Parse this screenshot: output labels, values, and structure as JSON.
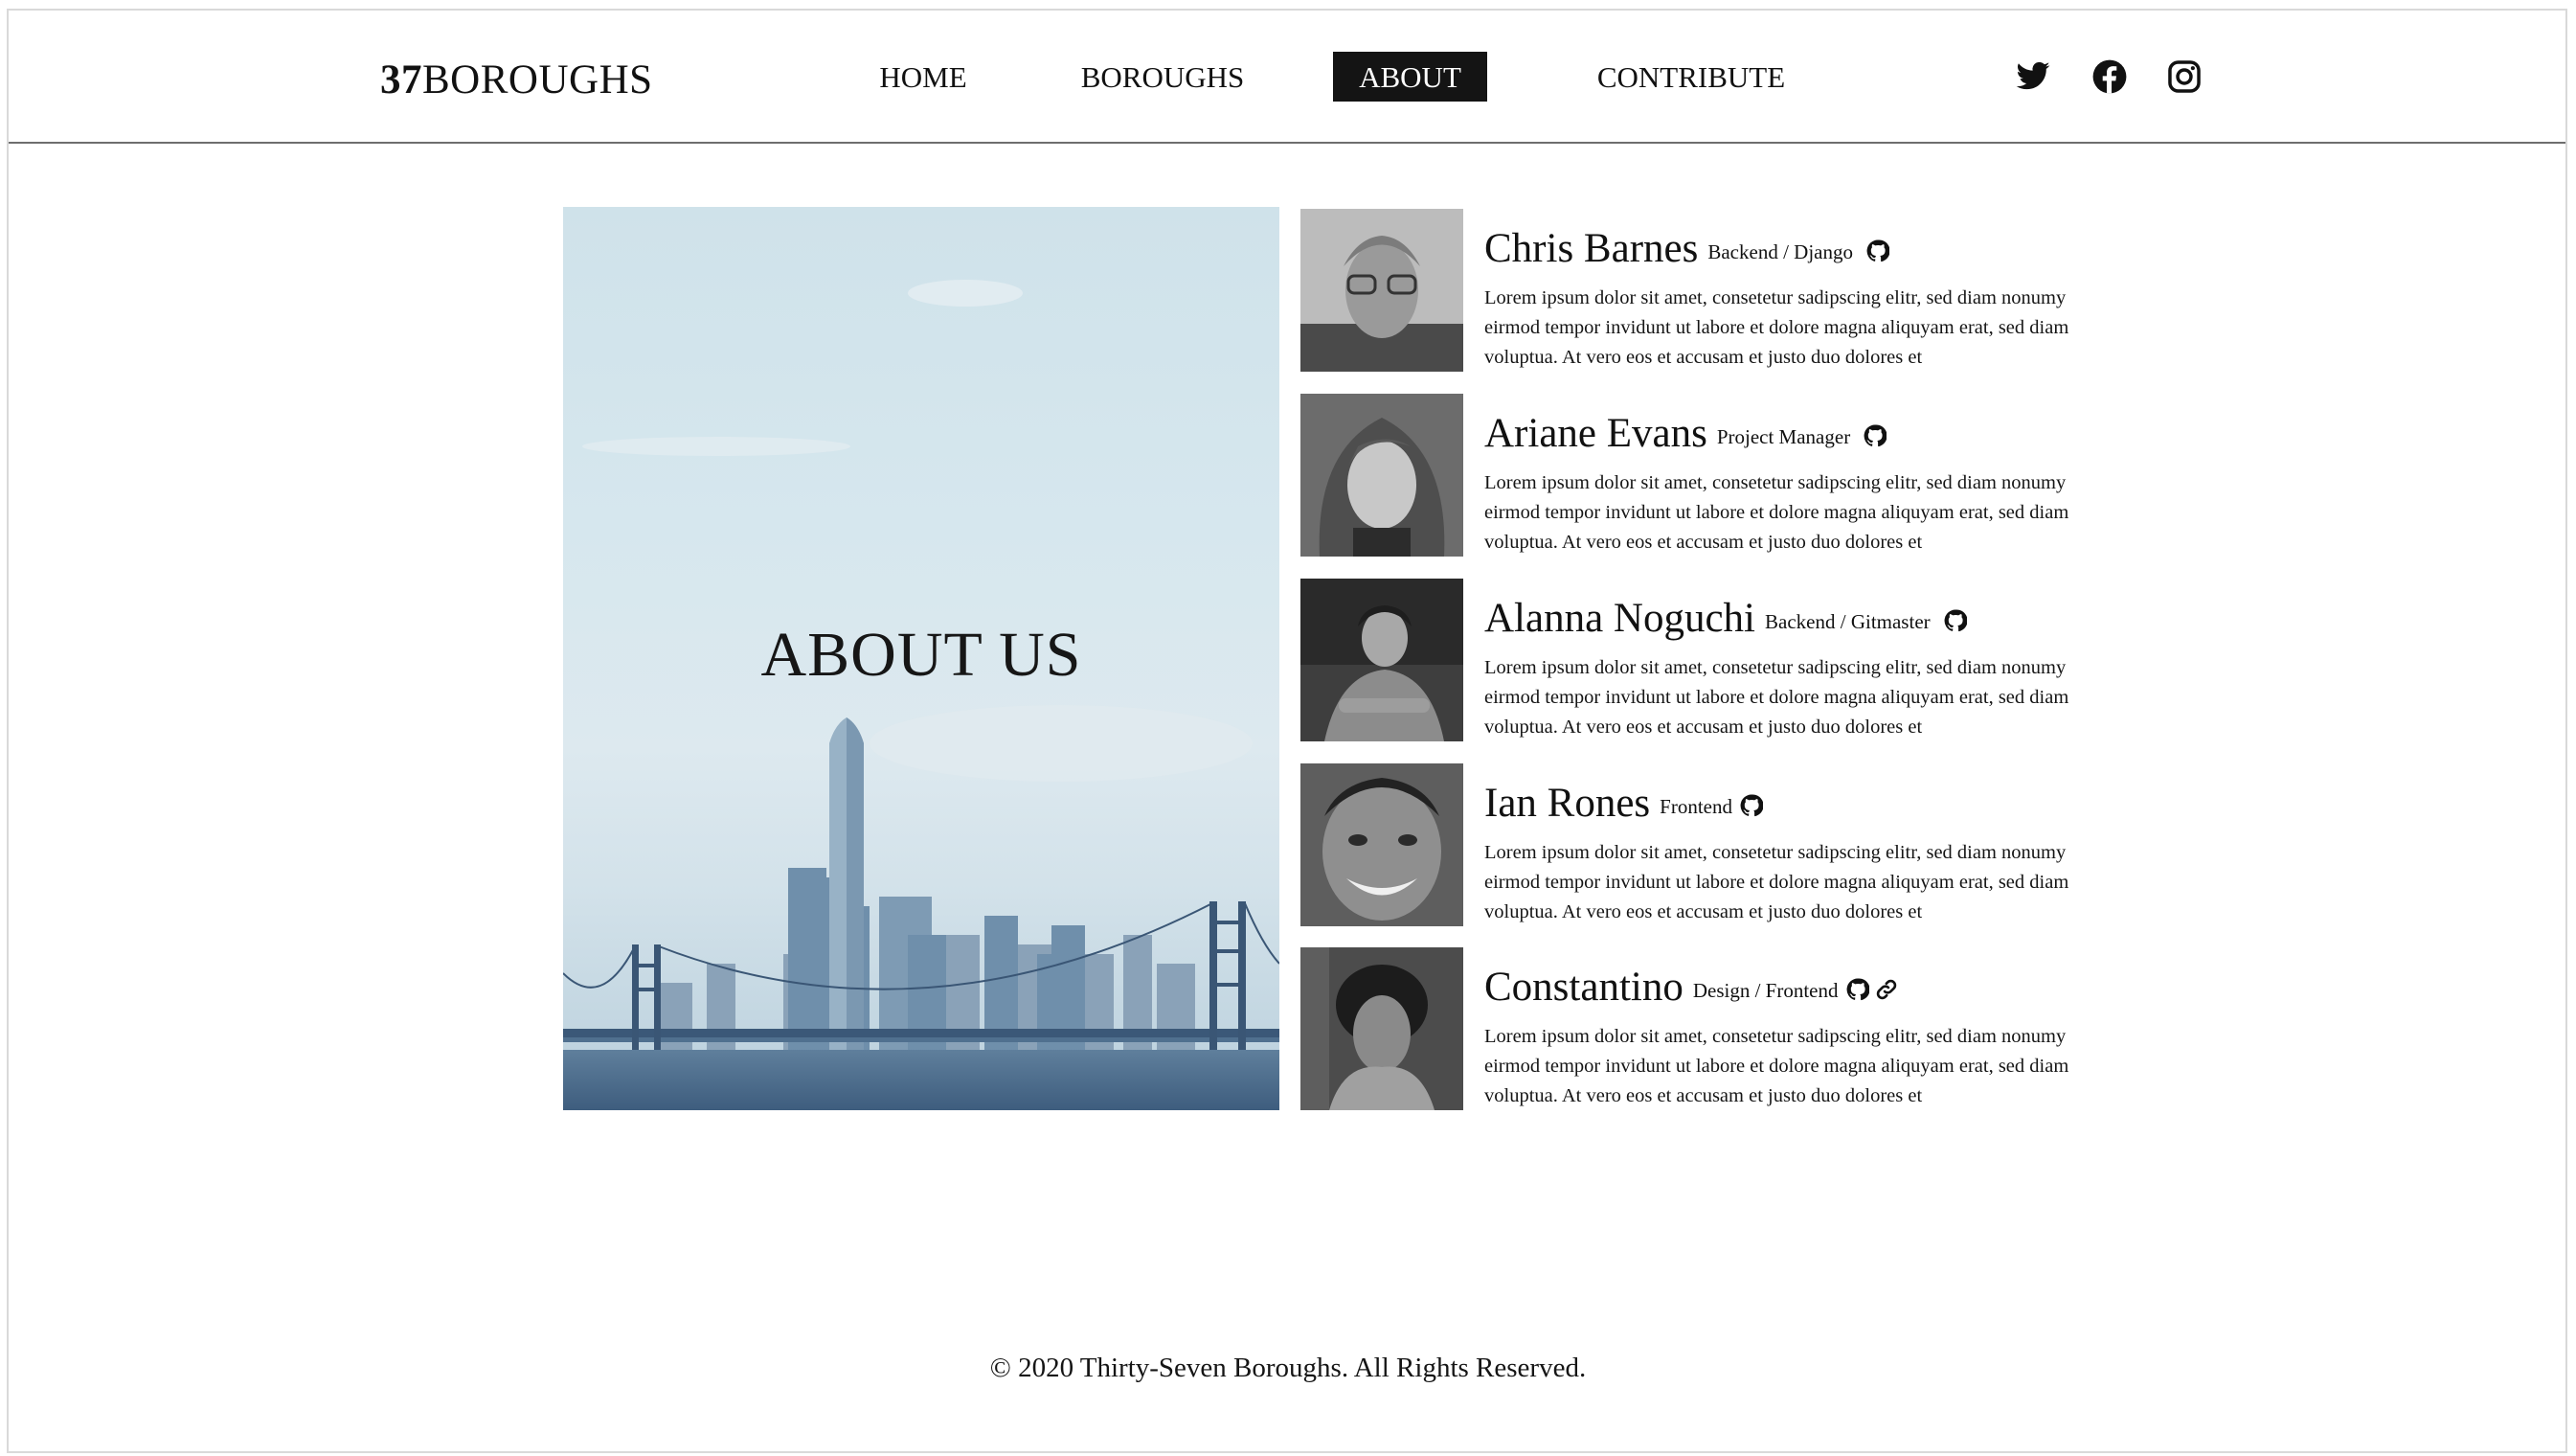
{
  "header": {
    "logo_number": "37",
    "logo_text": "BOROUGHS",
    "nav": [
      {
        "label": "HOME",
        "active": false
      },
      {
        "label": "BOROUGHS",
        "active": false
      },
      {
        "label": "ABOUT",
        "active": true
      },
      {
        "label": "CONTRIBUTE",
        "active": false
      }
    ],
    "social_icons": [
      "twitter-icon",
      "facebook-icon",
      "instagram-icon"
    ]
  },
  "hero": {
    "title": "ABOUT US"
  },
  "team": [
    {
      "name": "Chris Barnes",
      "role": "Backend / Django",
      "links": [
        "github-icon"
      ],
      "bio": "Lorem ipsum dolor sit amet, consetetur sadipscing elitr, sed diam nonumy eirmod tempor invidunt ut labore et dolore magna aliquyam erat, sed diam voluptua. At vero eos et accusam et justo duo dolores et"
    },
    {
      "name": "Ariane Evans",
      "role": "Project Manager",
      "links": [
        "github-icon"
      ],
      "bio": "Lorem ipsum dolor sit amet, consetetur sadipscing elitr, sed diam nonumy eirmod tempor invidunt ut labore et dolore magna aliquyam erat, sed diam voluptua. At vero eos et accusam et justo duo dolores et"
    },
    {
      "name": "Alanna Noguchi",
      "role": "Backend / Gitmaster",
      "links": [
        "github-icon"
      ],
      "bio": "Lorem ipsum dolor sit amet, consetetur sadipscing elitr, sed diam nonumy eirmod tempor invidunt ut labore et dolore magna aliquyam erat, sed diam voluptua. At vero eos et accusam et justo duo dolores et"
    },
    {
      "name": "Ian Rones",
      "role": "Frontend",
      "links": [
        "github-icon"
      ],
      "bio": "Lorem ipsum dolor sit amet, consetetur sadipscing elitr, sed diam nonumy eirmod tempor invidunt ut labore et dolore magna aliquyam erat, sed diam voluptua. At vero eos et accusam et justo duo dolores et"
    },
    {
      "name": "Constantino",
      "role": "Design / Frontend",
      "links": [
        "github-icon",
        "link-icon"
      ],
      "bio": "Lorem ipsum dolor sit amet, consetetur sadipscing elitr, sed diam nonumy eirmod tempor invidunt ut labore et dolore magna aliquyam erat, sed diam voluptua. At vero eos et accusam et justo duo dolores et"
    }
  ],
  "footer": {
    "copyright": "© 2020 Thirty-Seven Boroughs. All Rights Reserved."
  },
  "colors": {
    "nav_active_bg": "#141414",
    "text": "#111111",
    "header_rule": "#6e6e6e"
  }
}
